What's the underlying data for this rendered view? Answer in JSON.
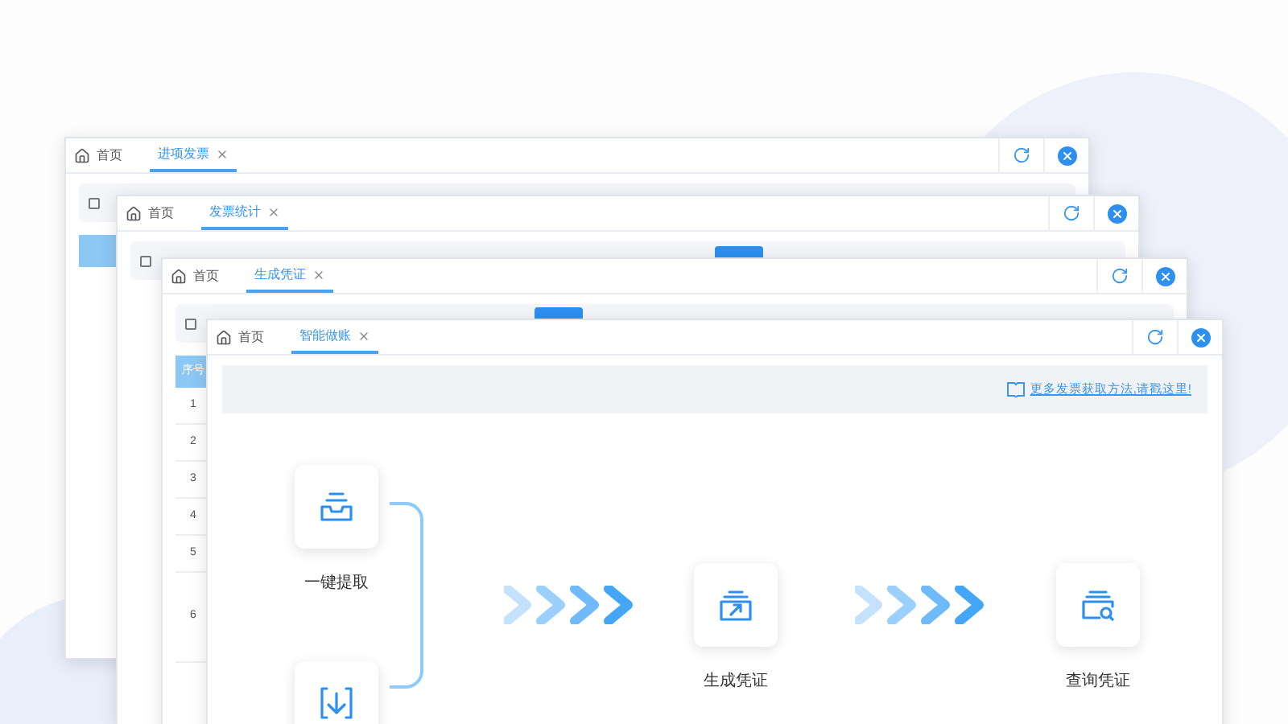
{
  "windows": [
    {
      "home_tab": "首页",
      "active_tab": "进项发票"
    },
    {
      "home_tab": "首页",
      "active_tab": "发票统计"
    },
    {
      "home_tab": "首页",
      "active_tab": "生成凭证",
      "column_header": "序号",
      "rows": [
        "1",
        "2",
        "3",
        "4",
        "5",
        "6"
      ]
    },
    {
      "home_tab": "首页",
      "active_tab": "智能做账"
    }
  ],
  "main": {
    "help_link": "更多发票获取方法,请戳这里!",
    "steps": [
      {
        "kind": "extract",
        "label": "一键提取"
      },
      {
        "kind": "import"
      },
      {
        "kind": "generate",
        "label": "生成凭证"
      },
      {
        "kind": "query",
        "label": "查询凭证"
      }
    ]
  }
}
